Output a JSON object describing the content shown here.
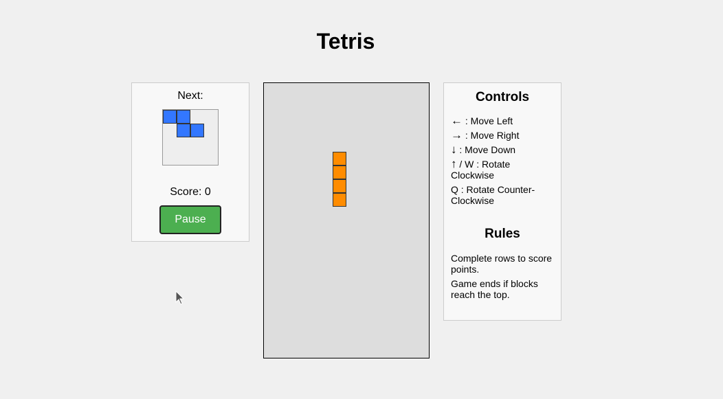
{
  "title": "Tetris",
  "next_panel": {
    "label": "Next:",
    "piece_color": "#3377ff",
    "piece_cells": [
      [
        0,
        0
      ],
      [
        1,
        0
      ],
      [
        1,
        1
      ],
      [
        2,
        1
      ]
    ]
  },
  "score": {
    "label": "Score: ",
    "value": "0"
  },
  "pause_button": {
    "label": "Pause",
    "color": "#4caf50"
  },
  "board": {
    "columns": 12,
    "rows": 20,
    "background": "#dddddd",
    "active_piece": {
      "color": "#ff8c00",
      "cells": [
        [
          5,
          5
        ],
        [
          5,
          6
        ],
        [
          5,
          7
        ],
        [
          5,
          8
        ]
      ]
    }
  },
  "controls": {
    "heading": "Controls",
    "items": [
      {
        "key": "←",
        "text": " : Move Left"
      },
      {
        "key": "→",
        "text": " : Move Right"
      },
      {
        "key": "↓",
        "text": " : Move Down"
      },
      {
        "key": "↑",
        "text": " / W : Rotate Clockwise"
      },
      {
        "key": "",
        "text": "Q : Rotate Counter-Clockwise"
      }
    ]
  },
  "rules": {
    "heading": "Rules",
    "items": [
      "Complete rows to score points.",
      "Game ends if blocks reach the top."
    ]
  },
  "icons": {
    "cursor": "mouse-pointer-icon"
  }
}
